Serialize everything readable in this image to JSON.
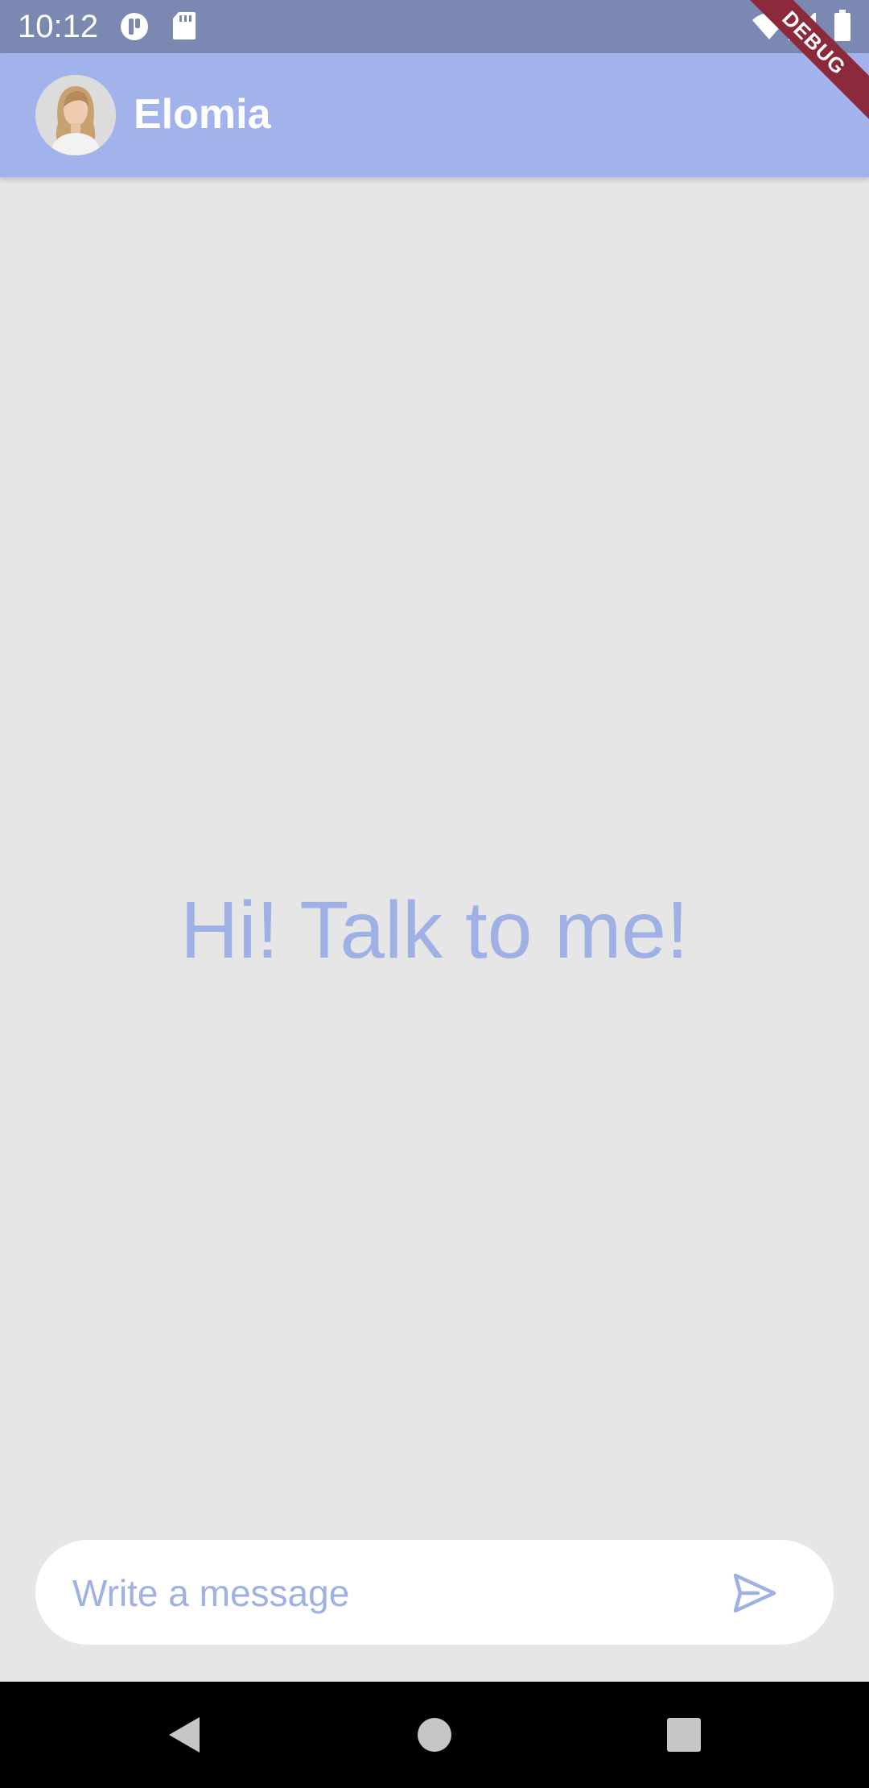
{
  "status_bar": {
    "time": "10:12",
    "icons_left": [
      "app-notification-icon",
      "sd-card-icon"
    ],
    "icons_right": [
      "wifi-icon",
      "cell-signal-icon",
      "battery-icon"
    ]
  },
  "app_bar": {
    "title": "Elomia",
    "avatar_icon": "profile-photo"
  },
  "debug_banner": {
    "label": "DEBUG"
  },
  "chat": {
    "empty_message": "Hi! Talk to me!"
  },
  "composer": {
    "placeholder": "Write a message",
    "value": "",
    "send_icon": "send-icon"
  },
  "nav_bar": {
    "buttons": [
      "back-icon",
      "home-icon",
      "recents-icon"
    ]
  },
  "colors": {
    "status_bar": "#7b89b2",
    "app_bar": "#a2b2ea",
    "accent": "#9fb0e4",
    "background": "#e6e6e6",
    "debug_banner": "#8c2a3c"
  }
}
